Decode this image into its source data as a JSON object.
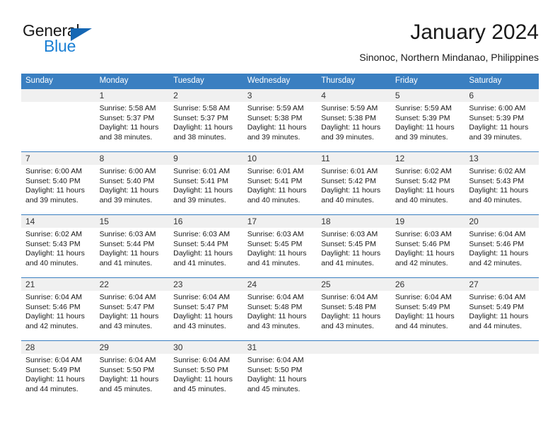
{
  "brand": {
    "name_part1": "General",
    "name_part2": "Blue",
    "triangle_color": "#1567b4",
    "blue_color": "#1a7fd4"
  },
  "header": {
    "month_title": "January 2024",
    "location": "Sinonoc, Northern Mindanao, Philippines"
  },
  "calendar": {
    "header_bg": "#3a7fc1",
    "daynum_bg": "#f0f0f0",
    "weekday_headers": [
      "Sunday",
      "Monday",
      "Tuesday",
      "Wednesday",
      "Thursday",
      "Friday",
      "Saturday"
    ],
    "weeks": [
      {
        "days": [
          {
            "date": "",
            "sunrise": "",
            "sunset": "",
            "daylight": "",
            "empty": true
          },
          {
            "date": "1",
            "sunrise": "Sunrise: 5:58 AM",
            "sunset": "Sunset: 5:37 PM",
            "daylight": "Daylight: 11 hours and 38 minutes.",
            "empty": false
          },
          {
            "date": "2",
            "sunrise": "Sunrise: 5:58 AM",
            "sunset": "Sunset: 5:37 PM",
            "daylight": "Daylight: 11 hours and 38 minutes.",
            "empty": false
          },
          {
            "date": "3",
            "sunrise": "Sunrise: 5:59 AM",
            "sunset": "Sunset: 5:38 PM",
            "daylight": "Daylight: 11 hours and 39 minutes.",
            "empty": false
          },
          {
            "date": "4",
            "sunrise": "Sunrise: 5:59 AM",
            "sunset": "Sunset: 5:38 PM",
            "daylight": "Daylight: 11 hours and 39 minutes.",
            "empty": false
          },
          {
            "date": "5",
            "sunrise": "Sunrise: 5:59 AM",
            "sunset": "Sunset: 5:39 PM",
            "daylight": "Daylight: 11 hours and 39 minutes.",
            "empty": false
          },
          {
            "date": "6",
            "sunrise": "Sunrise: 6:00 AM",
            "sunset": "Sunset: 5:39 PM",
            "daylight": "Daylight: 11 hours and 39 minutes.",
            "empty": false
          }
        ]
      },
      {
        "days": [
          {
            "date": "7",
            "sunrise": "Sunrise: 6:00 AM",
            "sunset": "Sunset: 5:40 PM",
            "daylight": "Daylight: 11 hours and 39 minutes.",
            "empty": false
          },
          {
            "date": "8",
            "sunrise": "Sunrise: 6:00 AM",
            "sunset": "Sunset: 5:40 PM",
            "daylight": "Daylight: 11 hours and 39 minutes.",
            "empty": false
          },
          {
            "date": "9",
            "sunrise": "Sunrise: 6:01 AM",
            "sunset": "Sunset: 5:41 PM",
            "daylight": "Daylight: 11 hours and 39 minutes.",
            "empty": false
          },
          {
            "date": "10",
            "sunrise": "Sunrise: 6:01 AM",
            "sunset": "Sunset: 5:41 PM",
            "daylight": "Daylight: 11 hours and 40 minutes.",
            "empty": false
          },
          {
            "date": "11",
            "sunrise": "Sunrise: 6:01 AM",
            "sunset": "Sunset: 5:42 PM",
            "daylight": "Daylight: 11 hours and 40 minutes.",
            "empty": false
          },
          {
            "date": "12",
            "sunrise": "Sunrise: 6:02 AM",
            "sunset": "Sunset: 5:42 PM",
            "daylight": "Daylight: 11 hours and 40 minutes.",
            "empty": false
          },
          {
            "date": "13",
            "sunrise": "Sunrise: 6:02 AM",
            "sunset": "Sunset: 5:43 PM",
            "daylight": "Daylight: 11 hours and 40 minutes.",
            "empty": false
          }
        ]
      },
      {
        "days": [
          {
            "date": "14",
            "sunrise": "Sunrise: 6:02 AM",
            "sunset": "Sunset: 5:43 PM",
            "daylight": "Daylight: 11 hours and 40 minutes.",
            "empty": false
          },
          {
            "date": "15",
            "sunrise": "Sunrise: 6:03 AM",
            "sunset": "Sunset: 5:44 PM",
            "daylight": "Daylight: 11 hours and 41 minutes.",
            "empty": false
          },
          {
            "date": "16",
            "sunrise": "Sunrise: 6:03 AM",
            "sunset": "Sunset: 5:44 PM",
            "daylight": "Daylight: 11 hours and 41 minutes.",
            "empty": false
          },
          {
            "date": "17",
            "sunrise": "Sunrise: 6:03 AM",
            "sunset": "Sunset: 5:45 PM",
            "daylight": "Daylight: 11 hours and 41 minutes.",
            "empty": false
          },
          {
            "date": "18",
            "sunrise": "Sunrise: 6:03 AM",
            "sunset": "Sunset: 5:45 PM",
            "daylight": "Daylight: 11 hours and 41 minutes.",
            "empty": false
          },
          {
            "date": "19",
            "sunrise": "Sunrise: 6:03 AM",
            "sunset": "Sunset: 5:46 PM",
            "daylight": "Daylight: 11 hours and 42 minutes.",
            "empty": false
          },
          {
            "date": "20",
            "sunrise": "Sunrise: 6:04 AM",
            "sunset": "Sunset: 5:46 PM",
            "daylight": "Daylight: 11 hours and 42 minutes.",
            "empty": false
          }
        ]
      },
      {
        "days": [
          {
            "date": "21",
            "sunrise": "Sunrise: 6:04 AM",
            "sunset": "Sunset: 5:46 PM",
            "daylight": "Daylight: 11 hours and 42 minutes.",
            "empty": false
          },
          {
            "date": "22",
            "sunrise": "Sunrise: 6:04 AM",
            "sunset": "Sunset: 5:47 PM",
            "daylight": "Daylight: 11 hours and 43 minutes.",
            "empty": false
          },
          {
            "date": "23",
            "sunrise": "Sunrise: 6:04 AM",
            "sunset": "Sunset: 5:47 PM",
            "daylight": "Daylight: 11 hours and 43 minutes.",
            "empty": false
          },
          {
            "date": "24",
            "sunrise": "Sunrise: 6:04 AM",
            "sunset": "Sunset: 5:48 PM",
            "daylight": "Daylight: 11 hours and 43 minutes.",
            "empty": false
          },
          {
            "date": "25",
            "sunrise": "Sunrise: 6:04 AM",
            "sunset": "Sunset: 5:48 PM",
            "daylight": "Daylight: 11 hours and 43 minutes.",
            "empty": false
          },
          {
            "date": "26",
            "sunrise": "Sunrise: 6:04 AM",
            "sunset": "Sunset: 5:49 PM",
            "daylight": "Daylight: 11 hours and 44 minutes.",
            "empty": false
          },
          {
            "date": "27",
            "sunrise": "Sunrise: 6:04 AM",
            "sunset": "Sunset: 5:49 PM",
            "daylight": "Daylight: 11 hours and 44 minutes.",
            "empty": false
          }
        ]
      },
      {
        "days": [
          {
            "date": "28",
            "sunrise": "Sunrise: 6:04 AM",
            "sunset": "Sunset: 5:49 PM",
            "daylight": "Daylight: 11 hours and 44 minutes.",
            "empty": false
          },
          {
            "date": "29",
            "sunrise": "Sunrise: 6:04 AM",
            "sunset": "Sunset: 5:50 PM",
            "daylight": "Daylight: 11 hours and 45 minutes.",
            "empty": false
          },
          {
            "date": "30",
            "sunrise": "Sunrise: 6:04 AM",
            "sunset": "Sunset: 5:50 PM",
            "daylight": "Daylight: 11 hours and 45 minutes.",
            "empty": false
          },
          {
            "date": "31",
            "sunrise": "Sunrise: 6:04 AM",
            "sunset": "Sunset: 5:50 PM",
            "daylight": "Daylight: 11 hours and 45 minutes.",
            "empty": false
          },
          {
            "date": "",
            "sunrise": "",
            "sunset": "",
            "daylight": "",
            "empty": true
          },
          {
            "date": "",
            "sunrise": "",
            "sunset": "",
            "daylight": "",
            "empty": true
          },
          {
            "date": "",
            "sunrise": "",
            "sunset": "",
            "daylight": "",
            "empty": true
          }
        ]
      }
    ]
  }
}
